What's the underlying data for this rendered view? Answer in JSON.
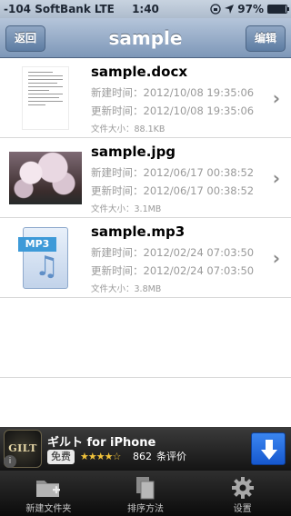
{
  "status_bar": {
    "carrier": "-104 SoftBank",
    "network": "LTE",
    "time": "1:40",
    "battery": "97%",
    "battery_level": 0.97
  },
  "nav": {
    "back_label": "返回",
    "title": "sample",
    "edit_label": "编辑"
  },
  "files": [
    {
      "name": "sample.docx",
      "created": "新建时间：2012/10/08 19:35:06",
      "updated": "更新时间：2012/10/08 19:35:06",
      "size": "文件大小：88.1KB",
      "thumb_type": "document"
    },
    {
      "name": "sample.jpg",
      "created": "新建时间：2012/06/17 00:38:52",
      "updated": "更新时间：2012/06/17 00:38:52",
      "size": "文件大小：3.1MB",
      "thumb_type": "photo"
    },
    {
      "name": "sample.mp3",
      "created": "新建时间：2012/02/24 07:03:50",
      "updated": "更新时间：2012/02/24 07:03:50",
      "size": "文件大小：3.8MB",
      "thumb_type": "audio",
      "thumb_tag": "MP3"
    }
  ],
  "ad": {
    "logo_text": "GILT",
    "title": "ギルト for iPhone",
    "price": "免费",
    "rating_stars": 4,
    "stars_display": "★★★★☆",
    "review_count": "862",
    "reviews_label": "条评价",
    "colors": {
      "stars": "#f1c33b",
      "download": "#2a6fe0"
    }
  },
  "tabs": [
    {
      "label": "新建文件夹",
      "icon": "new-folder-icon"
    },
    {
      "label": "排序方法",
      "icon": "sort-icon"
    },
    {
      "label": "设置",
      "icon": "gear-icon"
    }
  ],
  "colors": {
    "nav_bar": "#8ba3c4",
    "meta_text": "#9a9a9a",
    "tab_bar": "#1a1a1a"
  }
}
